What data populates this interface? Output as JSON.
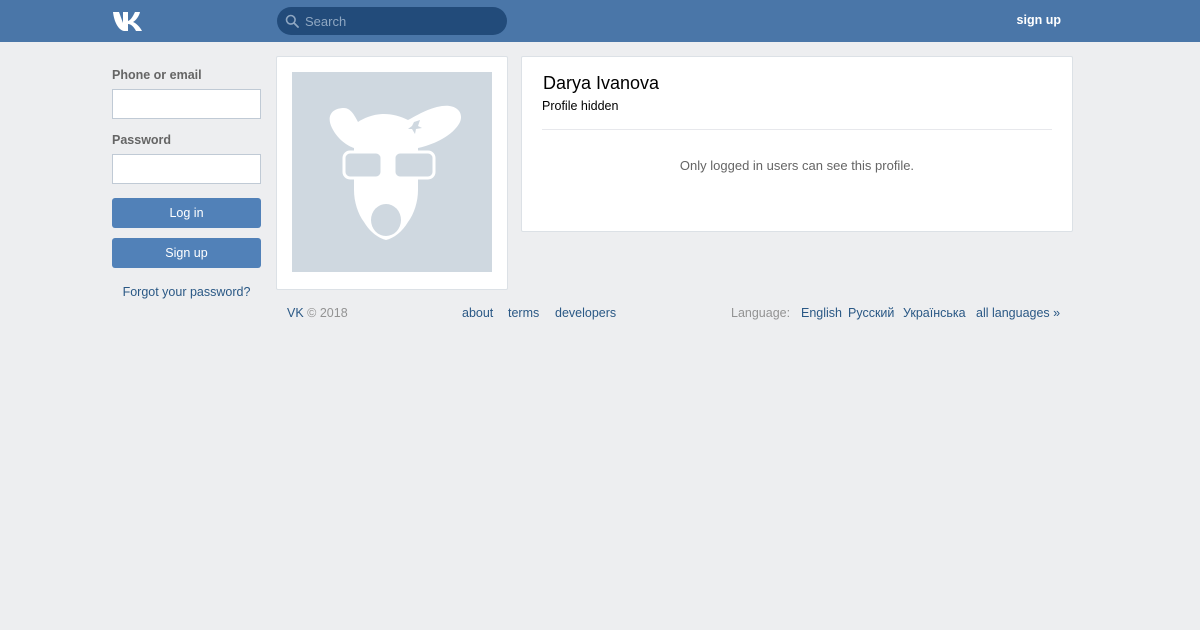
{
  "header": {
    "logo_icon": "vk-logo-icon",
    "search_placeholder": "Search",
    "signup_label": "sign up",
    "bar_color": "#4a76a8"
  },
  "login": {
    "phone_label": "Phone or email",
    "phone_value": "",
    "password_label": "Password",
    "password_value": "",
    "login_button": "Log in",
    "signup_button": "Sign up",
    "forgot_link": "Forgot your password?"
  },
  "profile": {
    "photo_icon": "deactivated-avatar-icon",
    "name": "Darya Ivanova",
    "status": "Profile hidden",
    "notice": "Only logged in users can see this profile."
  },
  "footer": {
    "brand": "VK",
    "copyright": "© 2018",
    "links": [
      "about",
      "terms",
      "developers"
    ],
    "language_label": "Language:",
    "languages": [
      "English",
      "Русский",
      "Українська",
      "all languages »"
    ]
  }
}
